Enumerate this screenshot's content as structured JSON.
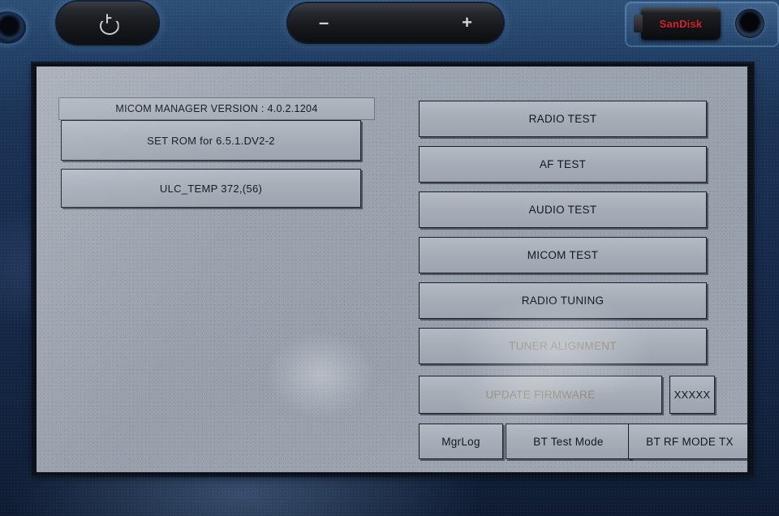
{
  "device": {
    "hardware": {
      "power_button": "power-icon",
      "volume_down": "–",
      "volume_up": "+",
      "usb_drive_label": "SanDisk",
      "aux_jack": "aux-jack",
      "top_left_port": "top-left-port"
    },
    "colors": {
      "bezel_blue": "#1b3355",
      "screen_grey": "#9ba3ae",
      "button_face": "#a7aeb8",
      "button_border": "#1c2028",
      "text": "#14181f",
      "disabled_text": "#8a8477",
      "sandisk_red": "#d8232a"
    }
  },
  "screen": {
    "left_panel": {
      "version_label": "MICOM MANAGER VERSION : 4.0.2.1204",
      "set_rom_button": "SET ROM for 6.5.1.DV2-2",
      "ulc_temp_button": "ULC_TEMP 372,(56)"
    },
    "right_panel": {
      "tests": [
        {
          "label": "RADIO TEST",
          "disabled": false
        },
        {
          "label": "AF TEST",
          "disabled": false
        },
        {
          "label": "AUDIO TEST",
          "disabled": false
        },
        {
          "label": "MICOM TEST",
          "disabled": false
        },
        {
          "label": "RADIO TUNING",
          "disabled": false
        },
        {
          "label": "TUNER ALIGNMENT",
          "disabled": true
        }
      ],
      "update_firmware_button": "UPDATE FIRMWARE",
      "firmware_code_button": "XXXXX",
      "bottom_row": [
        {
          "label": "MgrLog"
        },
        {
          "label": "BT Test Mode"
        },
        {
          "label": "BT RF MODE TX"
        }
      ]
    }
  }
}
